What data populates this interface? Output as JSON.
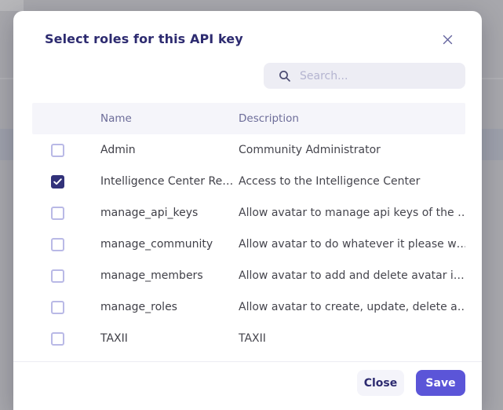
{
  "modal": {
    "title": "Select roles for this API key",
    "search": {
      "placeholder": "Search...",
      "icon": "magnifier"
    },
    "table": {
      "columns": [
        "Name",
        "Description"
      ],
      "rows": [
        {
          "name": "Admin",
          "description": "Community Administrator",
          "checked": false
        },
        {
          "name": "Intelligence Center Re…",
          "description": "Access to the Intelligence Center",
          "checked": true
        },
        {
          "name": "manage_api_keys",
          "description": "Allow avatar to manage api keys of the …",
          "checked": false
        },
        {
          "name": "manage_community",
          "description": "Allow avatar to do whatever it please w…",
          "checked": false
        },
        {
          "name": "manage_members",
          "description": "Allow avatar to add and delete avatar i…",
          "checked": false
        },
        {
          "name": "manage_roles",
          "description": "Allow avatar to create, update, delete a…",
          "checked": false
        },
        {
          "name": "TAXII",
          "description": "TAXII",
          "checked": false
        }
      ]
    },
    "footer": {
      "close_label": "Close",
      "save_label": "Save"
    }
  },
  "icons": {
    "close": "x-icon",
    "search": "search-icon",
    "check": "checkmark-icon"
  },
  "colors": {
    "accent": "#5b55d8",
    "title_text": "#2d2b70",
    "checkbox_checked": "#32327a",
    "header_row_bg": "#f5f5fa",
    "search_bg": "#ededf4",
    "overlay": "#a7a7ac"
  }
}
